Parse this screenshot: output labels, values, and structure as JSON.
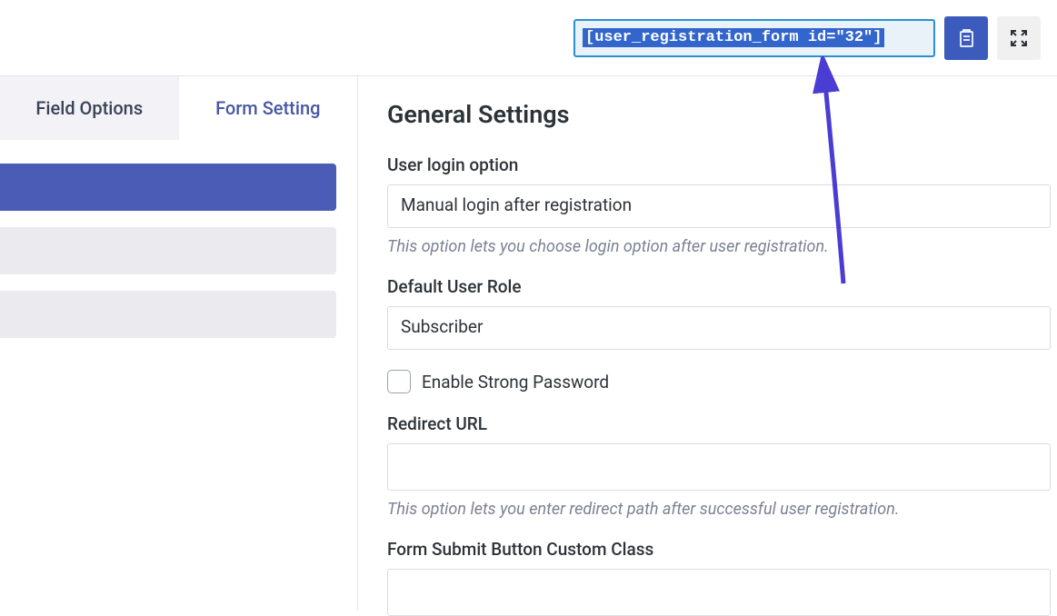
{
  "header": {
    "shortcode": "[user_registration_form id=\"32\"]"
  },
  "tabs": {
    "field_options": "Field Options",
    "form_setting": "Form Setting"
  },
  "content": {
    "title": "General Settings",
    "user_login": {
      "label": "User login option",
      "value": "Manual login after registration",
      "help": "This option lets you choose login option after user registration."
    },
    "default_role": {
      "label": "Default User Role",
      "value": "Subscriber"
    },
    "strong_password": {
      "label": "Enable Strong Password"
    },
    "redirect_url": {
      "label": "Redirect URL",
      "value": "",
      "help": "This option lets you enter redirect path after successful user registration."
    },
    "submit_button_class": {
      "label": "Form Submit Button Custom Class",
      "value": ""
    }
  }
}
